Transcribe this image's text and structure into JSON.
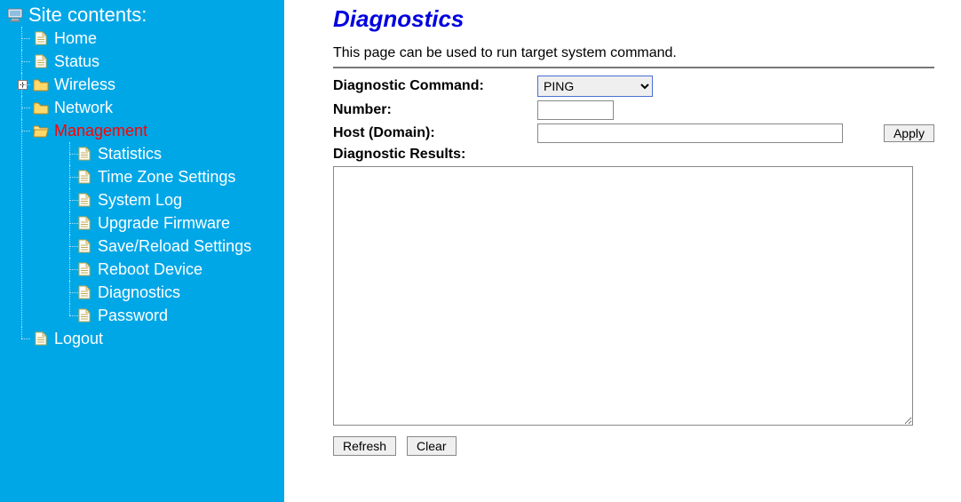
{
  "sidebar": {
    "title": "Site contents:",
    "items": [
      {
        "label": "Home",
        "icon": "file"
      },
      {
        "label": "Status",
        "icon": "file"
      },
      {
        "label": "Wireless",
        "icon": "folder-closed",
        "expandable": true
      },
      {
        "label": "Network",
        "icon": "folder-closed"
      },
      {
        "label": "Management",
        "icon": "folder-open",
        "active": true,
        "children": [
          {
            "label": "Statistics",
            "icon": "file"
          },
          {
            "label": "Time Zone Settings",
            "icon": "file"
          },
          {
            "label": "System Log",
            "icon": "file"
          },
          {
            "label": "Upgrade Firmware",
            "icon": "file"
          },
          {
            "label": "Save/Reload Settings",
            "icon": "file"
          },
          {
            "label": "Reboot Device",
            "icon": "file"
          },
          {
            "label": "Diagnostics",
            "icon": "file"
          },
          {
            "label": "Password",
            "icon": "file"
          }
        ]
      },
      {
        "label": "Logout",
        "icon": "file"
      }
    ]
  },
  "main": {
    "title": "Diagnostics",
    "description": "This page can be used to run target system command.",
    "labels": {
      "command": "Diagnostic Command:",
      "number": "Number:",
      "host": "Host (Domain):",
      "results": "Diagnostic Results:"
    },
    "command_select": {
      "selected": "PING",
      "options": [
        "PING"
      ]
    },
    "number_value": "",
    "host_value": "",
    "results_value": "",
    "buttons": {
      "apply": "Apply",
      "refresh": "Refresh",
      "clear": "Clear"
    }
  }
}
